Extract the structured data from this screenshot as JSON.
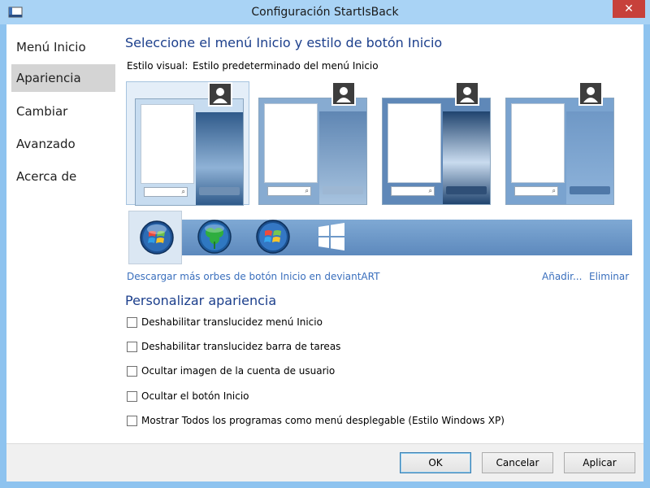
{
  "window": {
    "title": "Configuración StartIsBack",
    "close_glyph": "✕"
  },
  "sidebar": {
    "items": [
      {
        "label": "Menú Inicio"
      },
      {
        "label": "Apariencia",
        "active": true
      },
      {
        "label": "Cambiar"
      },
      {
        "label": "Avanzado"
      },
      {
        "label": "Acerca de"
      }
    ]
  },
  "appearance": {
    "heading": "Seleccione el menú Inicio y estilo de botón Inicio",
    "visual_style_label": "Estilo visual:",
    "visual_style_value": "Estilo predeterminado del menú Inicio",
    "styles": [
      {
        "name": "style-1",
        "selected": true
      },
      {
        "name": "style-2",
        "selected": false
      },
      {
        "name": "style-3",
        "selected": false
      },
      {
        "name": "style-4",
        "selected": false
      }
    ],
    "orbs": [
      {
        "icon": "windows7-orb-icon",
        "selected": true
      },
      {
        "icon": "shamrock-orb-icon",
        "selected": false
      },
      {
        "icon": "windows7-orb-alt-icon",
        "selected": false
      },
      {
        "icon": "windows8-logo-icon",
        "selected": false
      }
    ],
    "download_link": "Descargar más orbes de botón Inicio en deviantART",
    "add_link": "Añadir...",
    "remove_link": "Eliminar",
    "customize_heading": "Personalizar apariencia",
    "options": [
      {
        "label": "Deshabilitar translucidez menú Inicio",
        "checked": false
      },
      {
        "label": "Deshabilitar translucidez barra de tareas",
        "checked": false
      },
      {
        "label": "Ocultar imagen de la cuenta de usuario",
        "checked": false
      },
      {
        "label": "Ocultar el botón Inicio",
        "checked": false
      },
      {
        "label": "Mostrar Todos los programas como menú desplegable (Estilo Windows XP)",
        "checked": false
      }
    ]
  },
  "footer": {
    "ok_label": "OK",
    "cancel_label": "Cancelar",
    "apply_label": "Aplicar"
  },
  "colors": {
    "accent": "#1c3f8c",
    "link": "#3a6fbd",
    "frame": "#8ec3ef",
    "close": "#c7413b"
  }
}
